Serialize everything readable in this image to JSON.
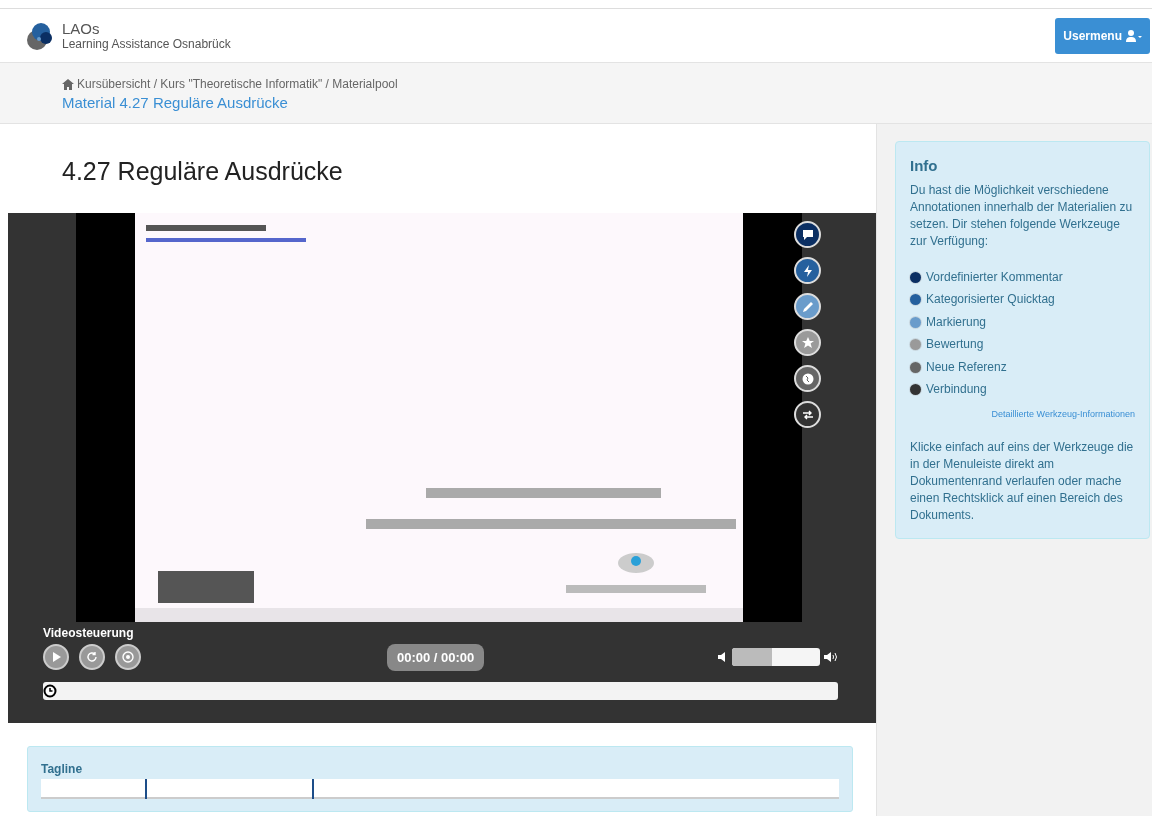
{
  "header": {
    "logo_title": "LAOs",
    "logo_subtitle": "Learning Assistance Osnabrück",
    "user_button": "Usermenu"
  },
  "breadcrumb": {
    "path": "Kursübersicht / Kurs \"Theoretische Informatik\" / Materialpool",
    "current": "Material 4.27 Reguläre Ausdrücke"
  },
  "page_title": "4.27 Reguläre Ausdrücke",
  "video": {
    "controls_label": "Videosteuerung",
    "time": "00:00 / 00:00",
    "volume": {
      "level": 0.45
    },
    "progress": {
      "level": 0
    }
  },
  "info": {
    "title": "Info",
    "intro": "Du hast die Möglichkeit verschiedene Annotationen innerhalb der Materialien zu setzen. Dir stehen folgende Werkzeuge zur Verfügung:",
    "tools": [
      {
        "label": "Vordefinierter Kommentar",
        "color": "#0b2f63",
        "kind": "comment"
      },
      {
        "label": "Kategorisierter Quicktag",
        "color": "#25609e",
        "kind": "quicktag"
      },
      {
        "label": "Markierung",
        "color": "#6a9ccb",
        "kind": "marker"
      },
      {
        "label": "Bewertung",
        "color": "#9a9a9a",
        "kind": "rating"
      },
      {
        "label": "Neue Referenz",
        "color": "#666666",
        "kind": "reference"
      },
      {
        "label": "Verbindung",
        "color": "#333333",
        "kind": "connection"
      }
    ],
    "details_link": "Detaillierte Werkzeug-Informationen",
    "outro": "Klicke einfach auf eins der Werkzeuge die in der Menuleiste direkt am Dokumentenrand verlaufen oder mache einen Rechtsklick auf einen Bereich des Dokuments."
  },
  "tagline": {
    "title": "Tagline"
  }
}
